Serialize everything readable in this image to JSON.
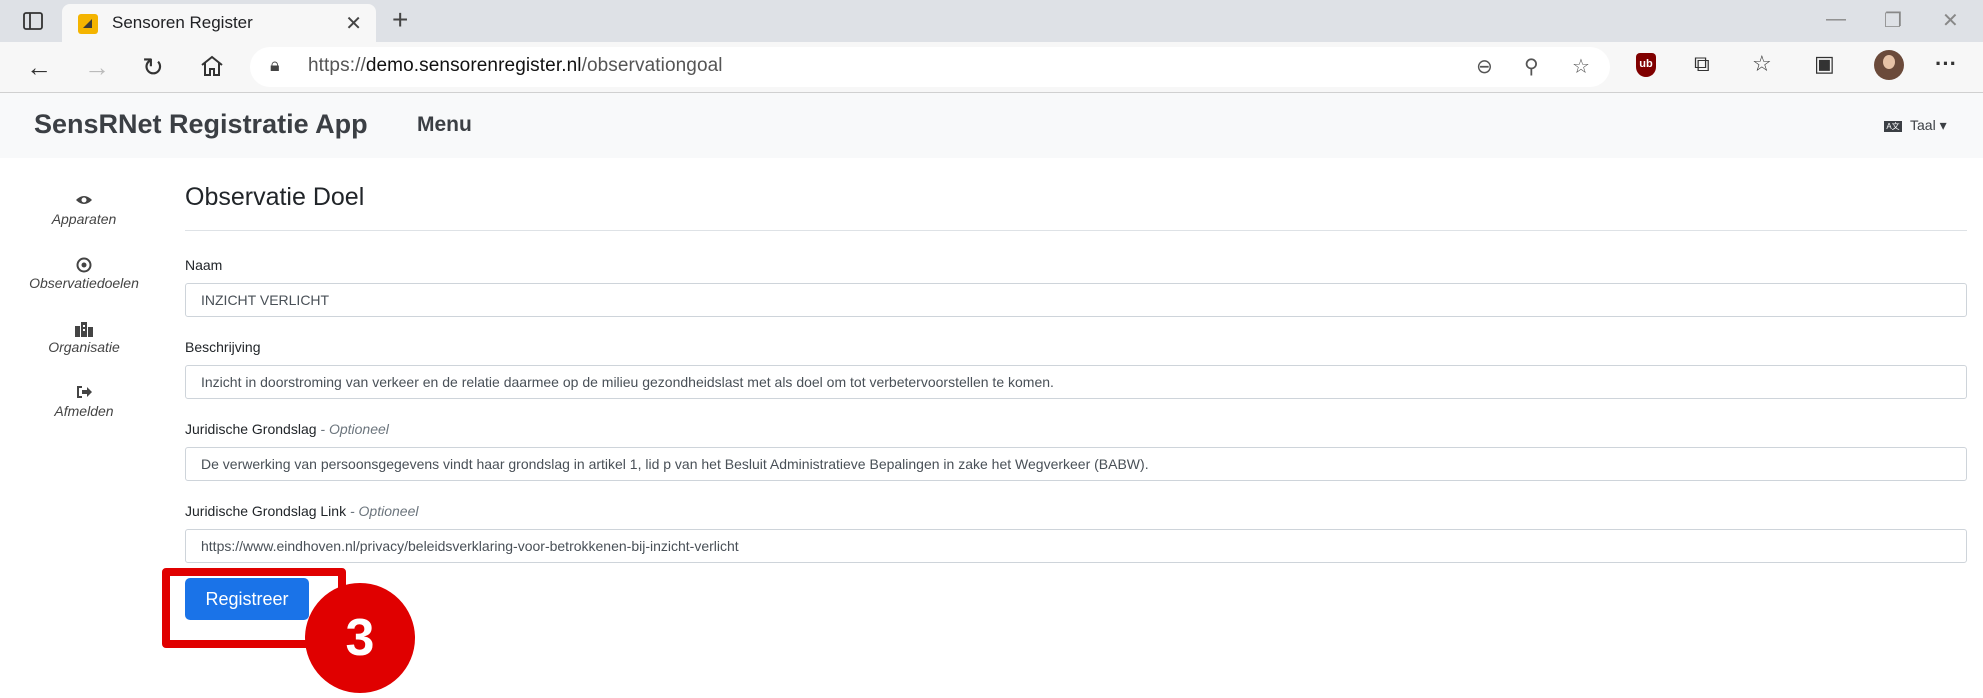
{
  "browser": {
    "tab_title": "Sensoren Register",
    "url_prefix": "https://",
    "url_host": "demo.sensorenregister.nl",
    "url_path": "/observationgoal"
  },
  "app": {
    "brand": "SensRNet Registratie App",
    "menu_label": "Menu",
    "language_label": "Taal"
  },
  "sidebar": {
    "items": [
      {
        "label": "Apparaten",
        "icon": "eye-icon"
      },
      {
        "label": "Observatiedoelen",
        "icon": "target-icon"
      },
      {
        "label": "Organisatie",
        "icon": "building-icon"
      },
      {
        "label": "Afmelden",
        "icon": "sign-out-icon"
      }
    ]
  },
  "form": {
    "title": "Observatie Doel",
    "optional_suffix": "- Optioneel",
    "fields": [
      {
        "label": "Naam",
        "value": "INZICHT VERLICHT"
      },
      {
        "label": "Beschrijving",
        "value": "Inzicht in doorstroming van verkeer en de relatie daarmee op de milieu gezondheidslast met als doel om tot verbetervoorstellen te komen."
      },
      {
        "label": "Juridische Grondslag",
        "value": "De verwerking van persoonsgegevens vindt haar grondslag in artikel 1, lid p van het Besluit Administratieve Bepalingen in zake het Wegverkeer (BABW)."
      },
      {
        "label": "Juridische Grondslag Link",
        "value": "https://www.eindhoven.nl/privacy/beleidsverklaring-voor-betrokkenen-bij-inzicht-verlicht"
      }
    ],
    "submit_label": "Registreer"
  },
  "annotation": {
    "step_number": "3",
    "color": "#e00000"
  }
}
